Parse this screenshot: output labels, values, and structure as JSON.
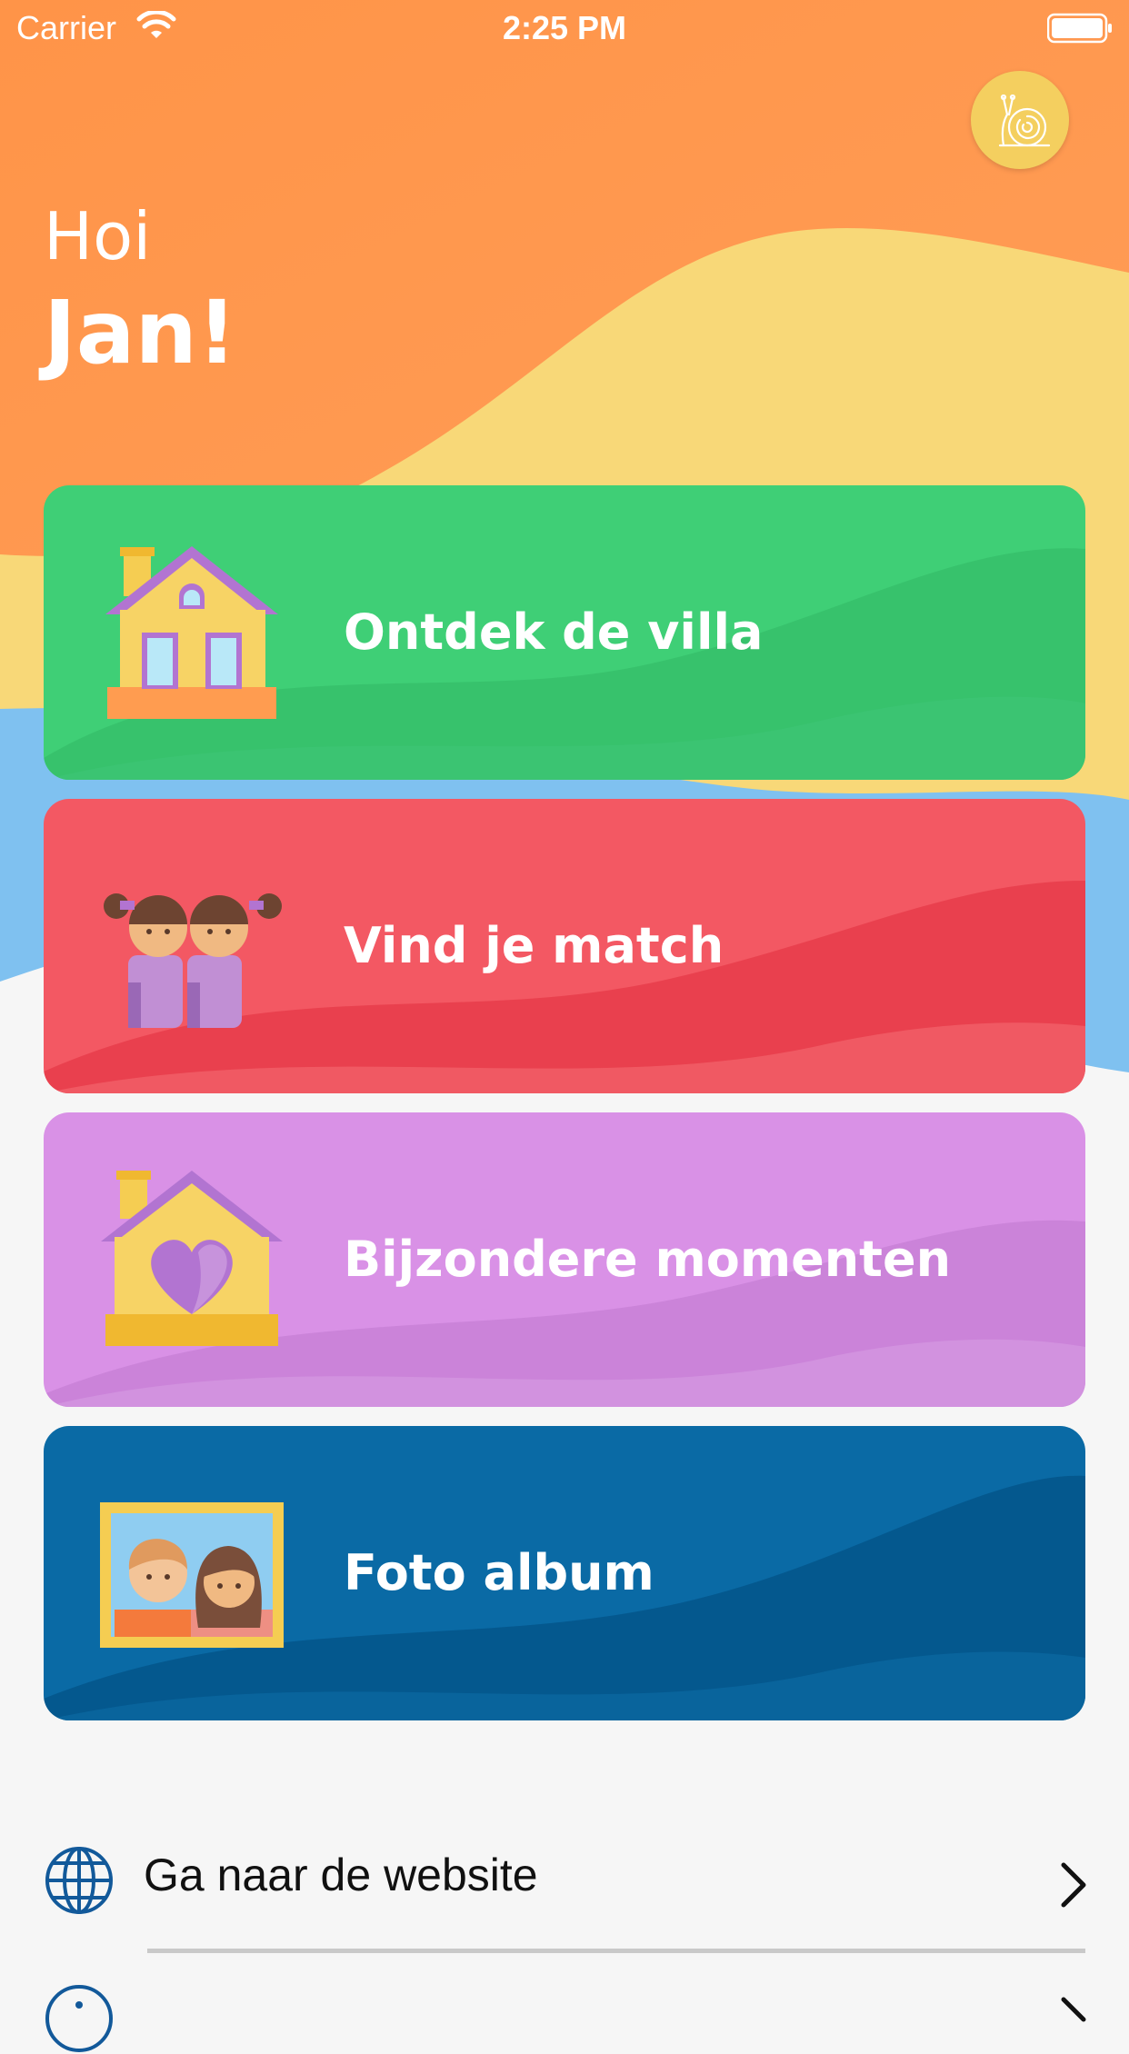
{
  "status_bar": {
    "carrier": "Carrier",
    "time": "2:25 PM"
  },
  "greeting": {
    "hello": "Hoi",
    "name": "Jan!"
  },
  "cards": [
    {
      "label": "Ontdek de villa",
      "icon": "house-icon",
      "color": "#3fcf76"
    },
    {
      "label": "Vind je match",
      "icon": "twins-icon",
      "color": "#f35863"
    },
    {
      "label": "Bijzondere momenten",
      "icon": "heart-house-icon",
      "color": "#d991e6"
    },
    {
      "label": "Foto album",
      "icon": "photo-frame-icon",
      "color": "#0a6aa5"
    }
  ],
  "links": [
    {
      "label": "Ga naar de website",
      "icon": "globe-icon"
    }
  ],
  "colors": {
    "orange": "#ff9a52",
    "yellow": "#f8d878",
    "blue": "#7fc1f0"
  }
}
